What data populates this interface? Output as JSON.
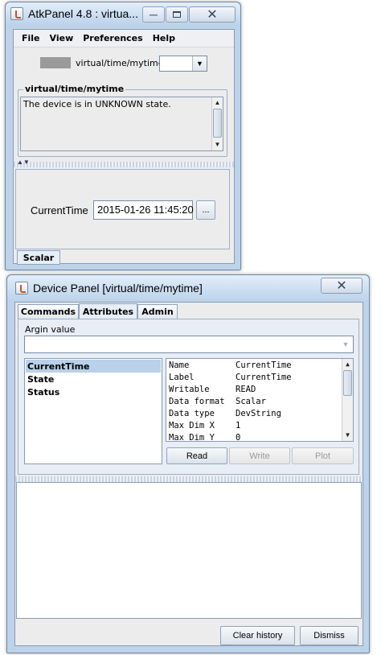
{
  "atk_panel": {
    "title": "AtkPanel  4.8 : virtua...",
    "menu": [
      "File",
      "View",
      "Preferences",
      "Help"
    ],
    "device_name": "virtual/time/mytime",
    "status_group_title": "virtual/time/mytime",
    "status_text": "The device is in UNKNOWN state.",
    "attribute_label": "CurrentTime",
    "attribute_value": "2015-01-26 11:45:20",
    "ellipsis_label": "...",
    "tab_label": "Scalar"
  },
  "device_panel": {
    "title": "Device Panel [virtual/time/mytime]",
    "tabs": [
      "Commands",
      "Attributes",
      "Admin"
    ],
    "selected_tab": "Attributes",
    "argin_label": "Argin value",
    "argin_value": "",
    "attributes": [
      "CurrentTime",
      "State",
      "Status"
    ],
    "selected_attribute": "CurrentTime",
    "properties": [
      {
        "key": "Name",
        "value": "CurrentTime"
      },
      {
        "key": "Label",
        "value": "CurrentTime"
      },
      {
        "key": "Writable",
        "value": "READ"
      },
      {
        "key": "Data format",
        "value": "Scalar"
      },
      {
        "key": "Data type",
        "value": "DevString"
      },
      {
        "key": "Max Dim X",
        "value": "1"
      },
      {
        "key": "Max Dim Y",
        "value": "0"
      }
    ],
    "buttons": {
      "read": "Read",
      "write": "Write",
      "plot": "Plot"
    },
    "history_text": "",
    "footer": {
      "clear_history": "Clear history",
      "dismiss": "Dismiss"
    }
  },
  "icons": {
    "app": "java-cup-icon",
    "minimize": "minimize-icon",
    "maximize": "maximize-icon",
    "close": "close-icon",
    "dropdown": "chevron-down-icon"
  }
}
